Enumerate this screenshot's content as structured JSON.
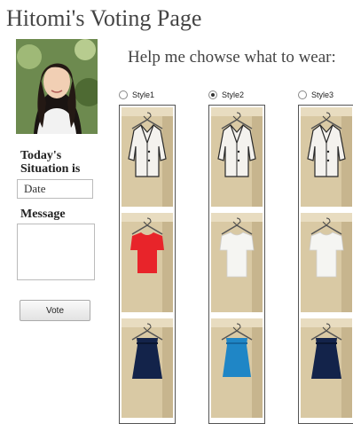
{
  "page": {
    "title": "Hitomi's Voting Page",
    "subtitle": "Help me chowse what to wear:"
  },
  "sidebar": {
    "situation_label": "Today's Situation is",
    "date_value": "Date",
    "message_label": "Message",
    "vote_label": "Vote"
  },
  "styles": [
    {
      "label": "Style1",
      "selected": false,
      "jacket": "white jacket",
      "top": "red top",
      "skirt": "navy skirt"
    },
    {
      "label": "Style2",
      "selected": true,
      "jacket": "white jacket",
      "top": "white top",
      "skirt": "blue skirt"
    },
    {
      "label": "Style3",
      "selected": false,
      "jacket": "white jacket",
      "top": "white top",
      "skirt": "navy skirt"
    }
  ],
  "colors": {
    "red_top": "#e8242a",
    "white_top": "#f5f5f2",
    "navy_skirt": "#13234a",
    "blue_skirt": "#1f86c6",
    "door": "#d9c9a4"
  }
}
